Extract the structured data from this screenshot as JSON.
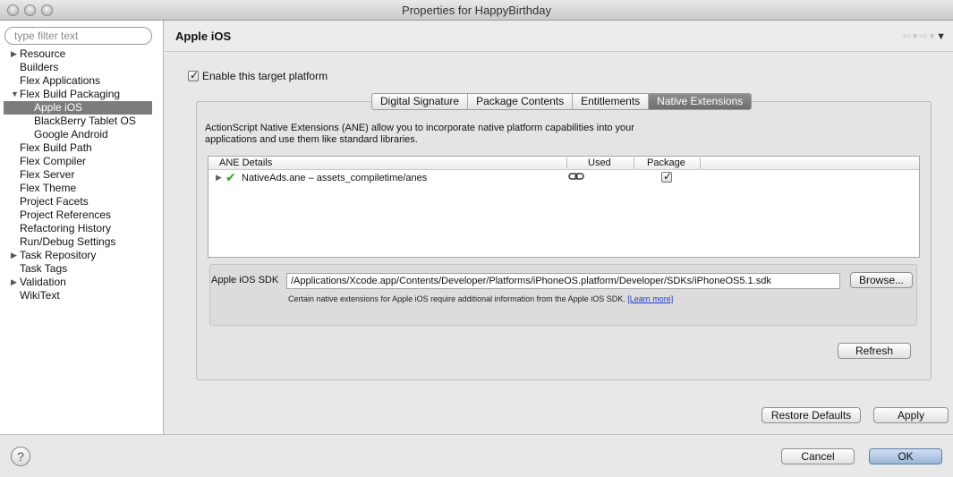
{
  "window": {
    "title": "Properties for HappyBirthday"
  },
  "sidebar": {
    "filter_placeholder": "type filter text",
    "items": [
      {
        "label": "Resource",
        "level": 0,
        "arrow": "▶"
      },
      {
        "label": "Builders",
        "level": 0,
        "arrow": ""
      },
      {
        "label": "Flex Applications",
        "level": 0,
        "arrow": ""
      },
      {
        "label": "Flex Build Packaging",
        "level": 0,
        "arrow": "▼"
      },
      {
        "label": "Apple iOS",
        "level": 1,
        "arrow": "",
        "selected": true
      },
      {
        "label": "BlackBerry Tablet OS",
        "level": 1,
        "arrow": ""
      },
      {
        "label": "Google Android",
        "level": 1,
        "arrow": ""
      },
      {
        "label": "Flex Build Path",
        "level": 0,
        "arrow": ""
      },
      {
        "label": "Flex Compiler",
        "level": 0,
        "arrow": ""
      },
      {
        "label": "Flex Server",
        "level": 0,
        "arrow": ""
      },
      {
        "label": "Flex Theme",
        "level": 0,
        "arrow": ""
      },
      {
        "label": "Project Facets",
        "level": 0,
        "arrow": ""
      },
      {
        "label": "Project References",
        "level": 0,
        "arrow": ""
      },
      {
        "label": "Refactoring History",
        "level": 0,
        "arrow": ""
      },
      {
        "label": "Run/Debug Settings",
        "level": 0,
        "arrow": ""
      },
      {
        "label": "Task Repository",
        "level": 0,
        "arrow": "▶"
      },
      {
        "label": "Task Tags",
        "level": 0,
        "arrow": ""
      },
      {
        "label": "Validation",
        "level": 0,
        "arrow": "▶"
      },
      {
        "label": "WikiText",
        "level": 0,
        "arrow": ""
      }
    ]
  },
  "header": {
    "title": "Apple iOS"
  },
  "enable_checkbox": {
    "label": "Enable this target platform",
    "checked": true
  },
  "tabs": [
    {
      "label": "Digital Signature",
      "active": false
    },
    {
      "label": "Package Contents",
      "active": false
    },
    {
      "label": "Entitlements",
      "active": false
    },
    {
      "label": "Native Extensions",
      "active": true
    }
  ],
  "description": "ActionScript Native Extensions (ANE) allow you to incorporate native platform capabilities into your applications and use them like standard libraries.",
  "ane_table": {
    "columns": [
      "ANE Details",
      "Used",
      "Package"
    ],
    "rows": [
      {
        "details": "NativeAds.ane – assets_compiletime/anes",
        "used_icon": "link-icon",
        "package_checked": true
      }
    ]
  },
  "sdk": {
    "label": "Apple iOS SDK",
    "path": "/Applications/Xcode.app/Contents/Developer/Platforms/iPhoneOS.platform/Developer/SDKs/iPhoneOS5.1.sdk",
    "browse_label": "Browse...",
    "note": "Certain native extensions for Apple iOS require additional information from the  Apple iOS SDK.",
    "learn_more": "[Learn more]"
  },
  "buttons": {
    "refresh": "Refresh",
    "restore_defaults": "Restore Defaults",
    "apply": "Apply",
    "cancel": "Cancel",
    "ok": "OK"
  },
  "help": {
    "glyph": "?"
  },
  "colors": {
    "selection": "#7c7c7c",
    "active_tab": "#7a7a7a",
    "check_green": "#2fa81c",
    "link": "#1f3cd0"
  }
}
